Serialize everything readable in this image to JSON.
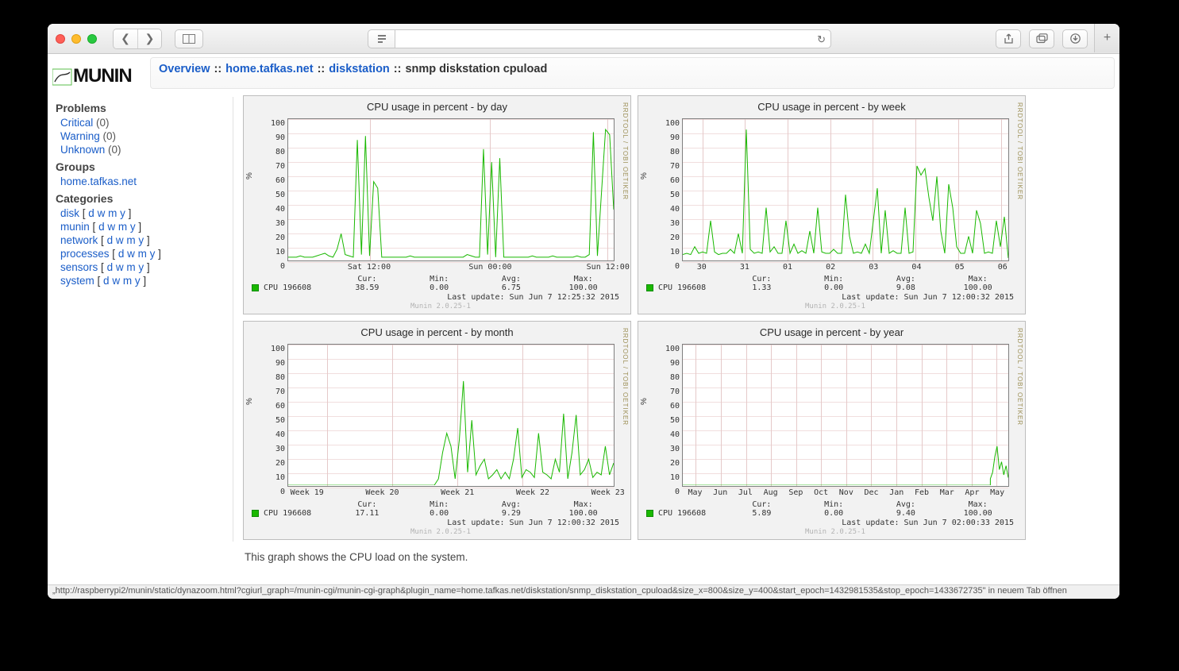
{
  "breadcrumb": {
    "overview": "Overview",
    "group": "home.tafkas.net",
    "host": "diskstation",
    "current": "snmp diskstation cpuload"
  },
  "logo_text": "MUNIN",
  "sidebar": {
    "problems_heading": "Problems",
    "critical": {
      "label": "Critical",
      "count": "(0)"
    },
    "warning": {
      "label": "Warning",
      "count": "(0)"
    },
    "unknown": {
      "label": "Unknown",
      "count": "(0)"
    },
    "groups_heading": "Groups",
    "group_link": "home.tafkas.net",
    "categories_heading": "Categories",
    "categories": [
      {
        "name": "disk"
      },
      {
        "name": "munin"
      },
      {
        "name": "network"
      },
      {
        "name": "processes"
      },
      {
        "name": "sensors"
      },
      {
        "name": "system"
      }
    ],
    "dwmy": {
      "d": "d",
      "w": "w",
      "m": "m",
      "y": "y"
    }
  },
  "charts": {
    "day": {
      "title": "CPU usage in percent - by day",
      "ylabel": "%",
      "legend": "CPU 196608",
      "xticks": [
        "Sat 12:00",
        "Sun 00:00",
        "Sun 12:00"
      ],
      "stats": {
        "Cur:": "38.59",
        "Min:": "0.00",
        "Avg:": "6.75",
        "Max:": "100.00"
      },
      "last_update": "Last update: Sun Jun  7 12:25:32 2015",
      "version": "Munin 2.0.25-1",
      "side": "RRDTOOL / TOBI OETIKER"
    },
    "week": {
      "title": "CPU usage in percent - by week",
      "ylabel": "%",
      "legend": "CPU 196608",
      "xticks": [
        "30",
        "31",
        "01",
        "02",
        "03",
        "04",
        "05",
        "06"
      ],
      "stats": {
        "Cur:": "1.33",
        "Min:": "0.00",
        "Avg:": "9.08",
        "Max:": "100.00"
      },
      "last_update": "Last update: Sun Jun  7 12:00:32 2015",
      "version": "Munin 2.0.25-1",
      "side": "RRDTOOL / TOBI OETIKER"
    },
    "month": {
      "title": "CPU usage in percent - by month",
      "ylabel": "%",
      "legend": "CPU 196608",
      "xticks": [
        "Week 19",
        "Week 20",
        "Week 21",
        "Week 22",
        "Week 23"
      ],
      "stats": {
        "Cur:": "17.11",
        "Min:": "0.00",
        "Avg:": "9.29",
        "Max:": "100.00"
      },
      "last_update": "Last update: Sun Jun  7 12:00:32 2015",
      "version": "Munin 2.0.25-1",
      "side": "RRDTOOL / TOBI OETIKER"
    },
    "year": {
      "title": "CPU usage in percent - by year",
      "ylabel": "%",
      "legend": "CPU 196608",
      "xticks": [
        "May",
        "Jun",
        "Jul",
        "Aug",
        "Sep",
        "Oct",
        "Nov",
        "Dec",
        "Jan",
        "Feb",
        "Mar",
        "Apr",
        "May"
      ],
      "stats": {
        "Cur:": "5.89",
        "Min:": "0.00",
        "Avg:": "9.40",
        "Max:": "100.00"
      },
      "last_update": "Last update: Sun Jun  7 02:00:33 2015",
      "version": "Munin 2.0.25-1",
      "side": "RRDTOOL / TOBI OETIKER"
    },
    "yticks": [
      "100",
      "90",
      "80",
      "70",
      "60",
      "50",
      "40",
      "30",
      "20",
      "10",
      "0"
    ]
  },
  "footer_desc": "This graph shows the CPU load on the system.",
  "status_bar": "„http://raspberrypi2/munin/static/dynazoom.html?cgiurl_graph=/munin-cgi/munin-cgi-graph&plugin_name=home.tafkas.net/diskstation/snmp_diskstation_cpuload&size_x=800&size_y=400&start_epoch=1432981535&stop_epoch=1433672735\" in neuem Tab öffnen",
  "chart_data": [
    {
      "id": "day",
      "type": "line",
      "title": "CPU usage in percent - by day",
      "xlabel": "",
      "ylabel": "%",
      "ylim": [
        0,
        108
      ],
      "x_categories": [
        "Sat 12:00",
        "Sun 00:00",
        "Sun 12:00"
      ],
      "series": [
        {
          "name": "CPU 196608",
          "color": "#19b800",
          "values": [
            2,
            2,
            2,
            3,
            2,
            2,
            2,
            3,
            4,
            5,
            3,
            2,
            8,
            20,
            4,
            3,
            2,
            92,
            4,
            95,
            3,
            60,
            55,
            2,
            2,
            2,
            2,
            2,
            2,
            2,
            3,
            2,
            2,
            2,
            2,
            2,
            2,
            2,
            2,
            2,
            2,
            2,
            2,
            2,
            4,
            3,
            2,
            2,
            85,
            4,
            75,
            2,
            78,
            2,
            2,
            2,
            2,
            2,
            2,
            2,
            3,
            2,
            2,
            2,
            2,
            3,
            2,
            2,
            2,
            2,
            2,
            3,
            2,
            2,
            4,
            98,
            3,
            52,
            100,
            96,
            38.59
          ]
        }
      ],
      "stats": {
        "cur": 38.59,
        "min": 0.0,
        "avg": 6.75,
        "max": 100.0
      }
    },
    {
      "id": "week",
      "type": "line",
      "title": "CPU usage in percent - by week",
      "xlabel": "",
      "ylabel": "%",
      "ylim": [
        0,
        108
      ],
      "x_categories": [
        "30",
        "31",
        "01",
        "02",
        "03",
        "04",
        "05",
        "06"
      ],
      "series": [
        {
          "name": "CPU 196608",
          "color": "#19b800",
          "values": [
            4,
            5,
            4,
            10,
            5,
            6,
            5,
            30,
            6,
            4,
            5,
            5,
            8,
            5,
            20,
            5,
            100,
            8,
            5,
            6,
            5,
            40,
            6,
            10,
            5,
            5,
            30,
            5,
            12,
            5,
            7,
            5,
            22,
            5,
            40,
            6,
            5,
            5,
            8,
            5,
            5,
            50,
            18,
            5,
            6,
            5,
            12,
            5,
            30,
            55,
            5,
            38,
            5,
            7,
            5,
            5,
            40,
            5,
            6,
            72,
            65,
            70,
            48,
            30,
            64,
            22,
            5,
            58,
            40,
            10,
            5,
            5,
            18,
            5,
            38,
            28,
            5,
            6,
            5,
            30,
            10,
            33,
            1.33
          ]
        }
      ],
      "stats": {
        "cur": 1.33,
        "min": 0.0,
        "avg": 9.08,
        "max": 100.0
      }
    },
    {
      "id": "month",
      "type": "line",
      "title": "CPU usage in percent - by month",
      "xlabel": "",
      "ylabel": "%",
      "ylim": [
        0,
        108
      ],
      "x_categories": [
        "Week 19",
        "Week 20",
        "Week 21",
        "Week 22",
        "Week 23"
      ],
      "series": [
        {
          "name": "CPU 196608",
          "color": "#19b800",
          "values": [
            0,
            0,
            0,
            0,
            0,
            0,
            0,
            0,
            0,
            0,
            0,
            0,
            0,
            0,
            0,
            0,
            0,
            0,
            0,
            0,
            0,
            0,
            0,
            0,
            0,
            0,
            0,
            0,
            0,
            0,
            0,
            0,
            0,
            0,
            0,
            0,
            5,
            25,
            40,
            30,
            5,
            35,
            80,
            10,
            50,
            8,
            15,
            20,
            5,
            8,
            12,
            5,
            10,
            5,
            20,
            44,
            6,
            12,
            10,
            6,
            40,
            10,
            8,
            5,
            20,
            10,
            55,
            5,
            25,
            54,
            8,
            12,
            20,
            6,
            10,
            8,
            30,
            8,
            17.11
          ]
        }
      ],
      "stats": {
        "cur": 17.11,
        "min": 0.0,
        "avg": 9.29,
        "max": 100.0
      }
    },
    {
      "id": "year",
      "type": "line",
      "title": "CPU usage in percent - by year",
      "xlabel": "",
      "ylabel": "%",
      "ylim": [
        0,
        108
      ],
      "x_categories": [
        "May",
        "Jun",
        "Jul",
        "Aug",
        "Sep",
        "Oct",
        "Nov",
        "Dec",
        "Jan",
        "Feb",
        "Mar",
        "Apr",
        "May"
      ],
      "series": [
        {
          "name": "CPU 196608",
          "color": "#19b800",
          "values_sparse": {
            "start_frac": 0.945,
            "values": [
              5,
              10,
              22,
              30,
              12,
              18,
              8,
              15,
              5.89
            ]
          }
        }
      ],
      "stats": {
        "cur": 5.89,
        "min": 0.0,
        "avg": 9.4,
        "max": 100.0
      }
    }
  ]
}
